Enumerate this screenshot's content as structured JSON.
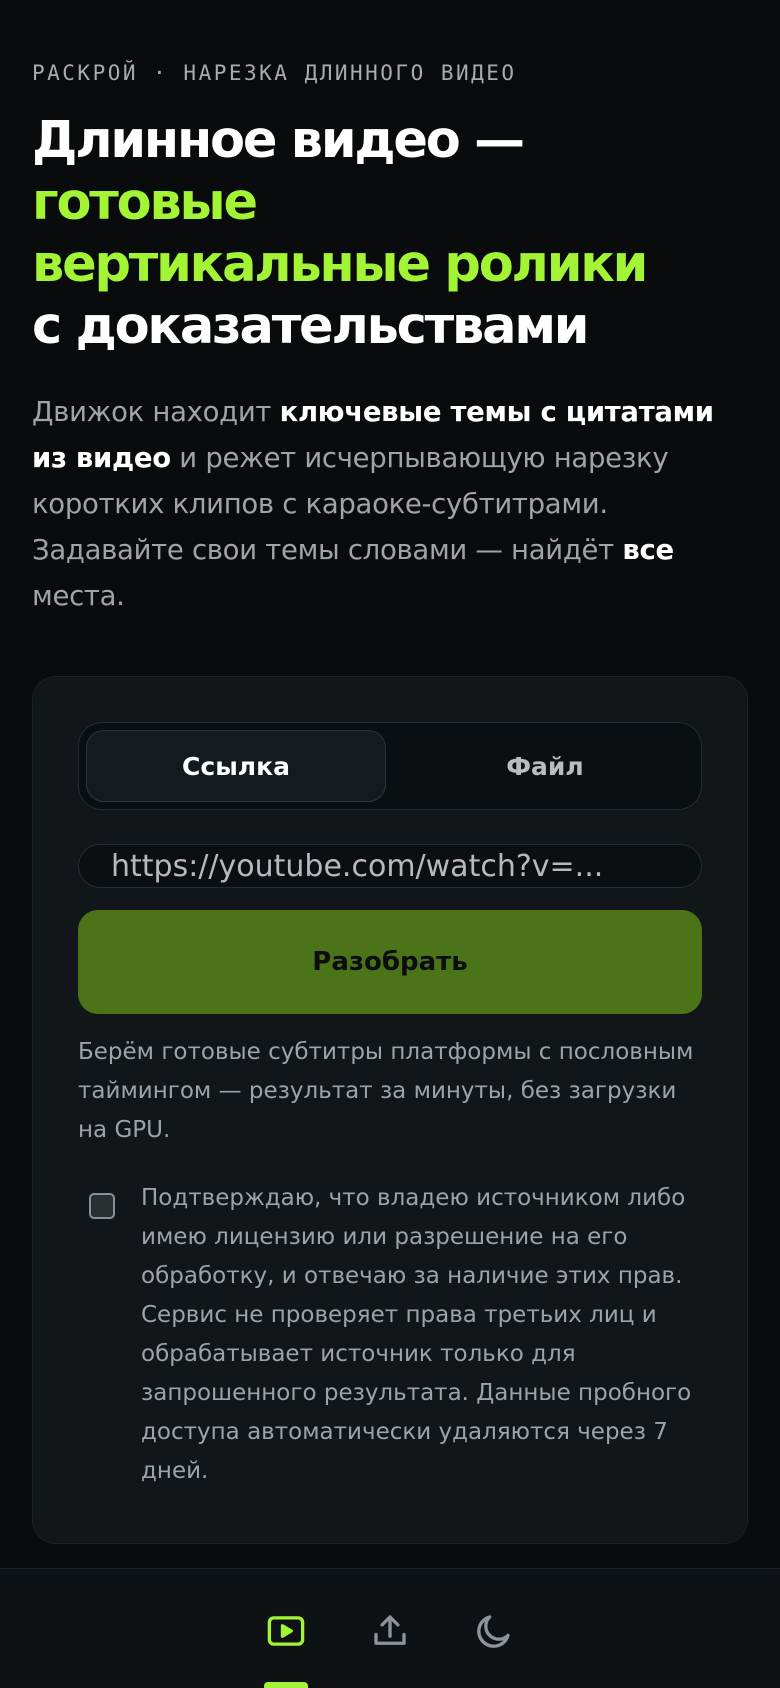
{
  "header": {
    "eyebrow": "РАСКРОЙ · НАРЕЗКА ДЛИННОГО ВИДЕО",
    "title_line_1": "Длинное видео —",
    "title_line_2": "готовые",
    "title_line_3": "вертикальные ролики",
    "title_line_4": "с доказательствами"
  },
  "lead": {
    "part_1": "Движок находит ",
    "bold_1": "ключевые темы с цитатами из видео",
    "part_2": " и режет исчерпывающую нарезку коротких клипов с караоке-субтитрами. Задавайте свои темы словами — найдёт ",
    "bold_2": "все",
    "part_3": " места."
  },
  "form": {
    "tabs": [
      {
        "label": "Ссылка",
        "active": true
      },
      {
        "label": "Файл",
        "active": false
      }
    ],
    "url_placeholder": "https://youtube.com/watch?v=...",
    "submit_label": "Разобрать",
    "note": "Берём готовые субтитры платформы с пословным таймингом — результат за минуты, без загрузки на GPU.",
    "consent_checked": false,
    "consent_text": "Подтверждаю, что владею источником либо имею лицензию или разрешение на его обработку, и отвечаю за наличие этих прав. Сервис не проверяет права третьих лиц и обрабатывает источник только для запрошенного результата. Данные пробного доступа автоматически удаляются через 7 дней."
  },
  "bottom_nav": {
    "items": [
      {
        "icon": "video-play-icon",
        "active": true
      },
      {
        "icon": "upload-icon",
        "active": false
      },
      {
        "icon": "moon-icon",
        "active": false
      }
    ]
  },
  "colors": {
    "background": "#090b0c",
    "accent": "#a3f435",
    "button": "#4b7418",
    "card": "#121618",
    "muted_text": "#9fa4a8"
  }
}
